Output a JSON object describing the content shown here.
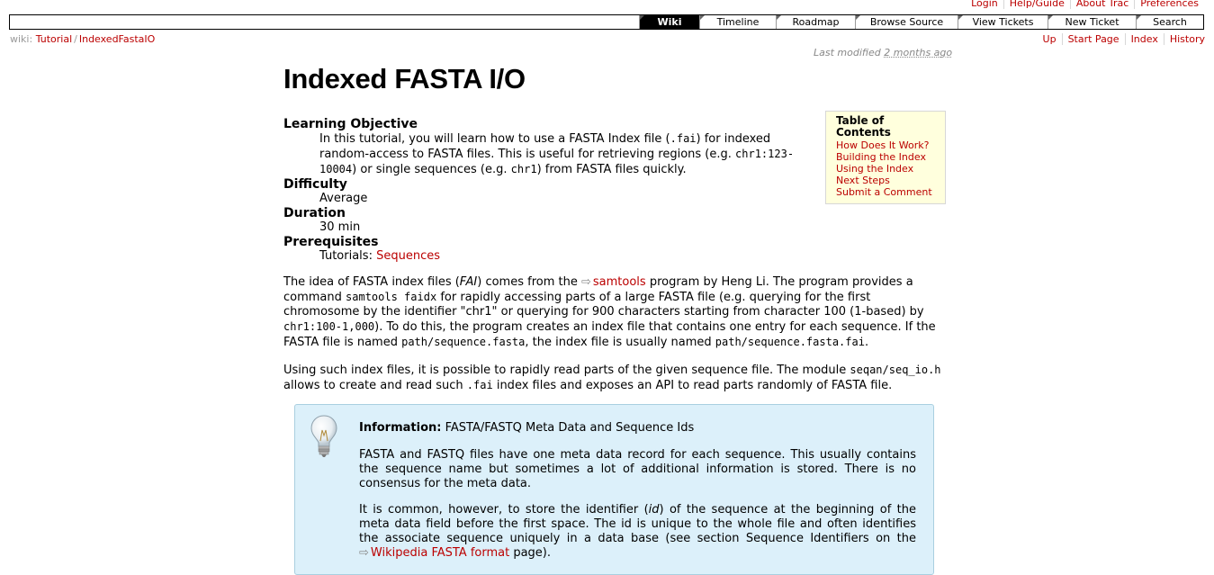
{
  "metanav": [
    "Login",
    "Help/Guide",
    "About Trac",
    "Preferences"
  ],
  "mainnav": [
    {
      "label": "Wiki",
      "active": true
    },
    {
      "label": "Timeline"
    },
    {
      "label": "Roadmap"
    },
    {
      "label": "Browse Source"
    },
    {
      "label": "View Tickets"
    },
    {
      "label": "New Ticket"
    },
    {
      "label": "Search"
    }
  ],
  "breadcrumb": {
    "prefix": "wiki:",
    "items": [
      "Tutorial",
      "IndexedFastaIO"
    ],
    "separator": "/"
  },
  "ctxtnav": [
    "Up",
    "Start Page",
    "Index",
    "History"
  ],
  "lastmod": {
    "prefix": "Last modified",
    "age": "2 months ago"
  },
  "title": "Indexed FASTA I/O",
  "meta": {
    "objective_term": "Learning Objective",
    "objective_1": "In this tutorial, you will learn how to use a FASTA Index file (",
    "objective_code1": ".fai",
    "objective_2": ") for indexed random-access to FASTA files. This is useful for retrieving regions (e.g. ",
    "objective_code2": "chr1:123-10004",
    "objective_3": ") or single sequences (e.g. ",
    "objective_code3": "chr1",
    "objective_4": ") from FASTA files quickly.",
    "difficulty_term": "Difficulty",
    "difficulty": "Average",
    "duration_term": "Duration",
    "duration": "30 min",
    "prereq_term": "Prerequisites",
    "prereq_prefix": "Tutorials:",
    "prereq_link": "Sequences"
  },
  "para1": {
    "t1": "The idea of FASTA index files (",
    "fai": "FAI",
    "t2": ") comes from the ",
    "samtools": "samtools",
    "t3": " program by Heng Li. The program provides a command ",
    "c1": "samtools faidx",
    "t4": " for rapidly accessing parts of a large FASTA file (e.g. querying for the first chromosome by the identifier \"chr1\" or querying for 900 characters starting from character 100 (1-based) by ",
    "c2": "chr1:100-1,000",
    "t5": "). To do this, the program creates an index file that contains one entry for each sequence. If the FASTA file is named ",
    "c3": "path/sequence.fasta",
    "t6": ", the index file is usually named ",
    "c4": "path/sequence.fasta.fai",
    "t7": "."
  },
  "para2": {
    "t1": "Using such index files, it is possible to rapidly read parts of the given sequence file. The module ",
    "c1": "seqan/seq_io.h",
    "t2": " allows to create and read such ",
    "c2": ".fai",
    "t3": " index files and exposes an API to read parts randomly of FASTA file."
  },
  "toc": {
    "title": "Table of Contents",
    "items": [
      "How Does It Work?",
      "Building the Index",
      "Using the Index",
      "Next Steps",
      "Submit a Comment"
    ]
  },
  "info": {
    "label": "Information:",
    "heading": "FASTA/FASTQ Meta Data and Sequence Ids",
    "p1": "FASTA and FASTQ files have one meta data record for each sequence. This usually contains the sequence name but sometimes a lot of additional information is stored. There is no consensus for the meta data.",
    "p2_1": "It is common, however, to store the identifier (",
    "p2_id": "id",
    "p2_2": ") of the sequence at the beginning of the meta data field before the first space. The id is unique to the whole file and often identifies the associate sequence uniquely in a data base (see section Sequence Identifiers on the ",
    "p2_link": "Wikipedia FASTA format",
    "p2_3": " page)."
  }
}
